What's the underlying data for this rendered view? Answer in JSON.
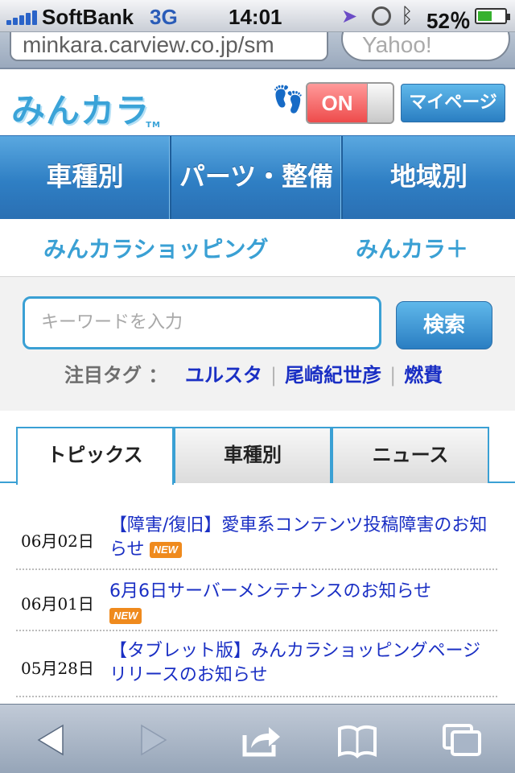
{
  "status_bar": {
    "carrier": "SoftBank",
    "network": "3G",
    "time": "14:01",
    "battery_percent": "52％",
    "battery_level": 0.52,
    "icons": [
      "signal-icon",
      "location-arrow-icon",
      "clock-icon",
      "bluetooth-icon",
      "battery-icon"
    ]
  },
  "browser": {
    "url": "minkara.carview.co.jp/sm",
    "search_placeholder": "Yahoo!"
  },
  "header": {
    "logo_text": "みんカラ",
    "logo_tm": "TM",
    "toggle_label": "ON",
    "mypage_label": "マイページ"
  },
  "main_nav": {
    "items": [
      {
        "label": "車種別"
      },
      {
        "label": "パーツ・整備"
      },
      {
        "label": "地域別"
      }
    ]
  },
  "sub_links": {
    "shopping": "みんカラショッピング",
    "plus": "みんカラ＋"
  },
  "search": {
    "placeholder": "キーワードを入力",
    "button_label": "検索",
    "tags_label": "注目タグ ：",
    "tags": [
      "ユルスタ",
      "尾崎紀世彦",
      "燃費"
    ],
    "separator": "|"
  },
  "tabs": {
    "items": [
      {
        "label": "トピックス",
        "active": true
      },
      {
        "label": "車種別",
        "active": false
      },
      {
        "label": "ニュース",
        "active": false
      }
    ]
  },
  "news": {
    "badge_label": "NEW",
    "items": [
      {
        "date": "06月02日",
        "title": "【障害/復旧】愛車系コンテンツ投稿障害のお知らせ",
        "is_new": true
      },
      {
        "date": "06月01日",
        "title": "6月6日サーバーメンテナンスのお知らせ",
        "is_new": true
      },
      {
        "date": "05月28日",
        "title": "【タブレット版】みんカラショッピングページリリースのお知らせ",
        "is_new": false
      }
    ]
  },
  "toolbar": {
    "icons": [
      "back-arrow-icon",
      "forward-arrow-icon",
      "share-icon",
      "bookmarks-icon",
      "pages-icon"
    ]
  },
  "colors": {
    "accent_blue": "#3aa0d4",
    "nav_blue": "#2f7fc4",
    "link_blue": "#1a2fc4",
    "toggle_red": "#ee4b4b",
    "new_badge": "#ef8a1d"
  }
}
